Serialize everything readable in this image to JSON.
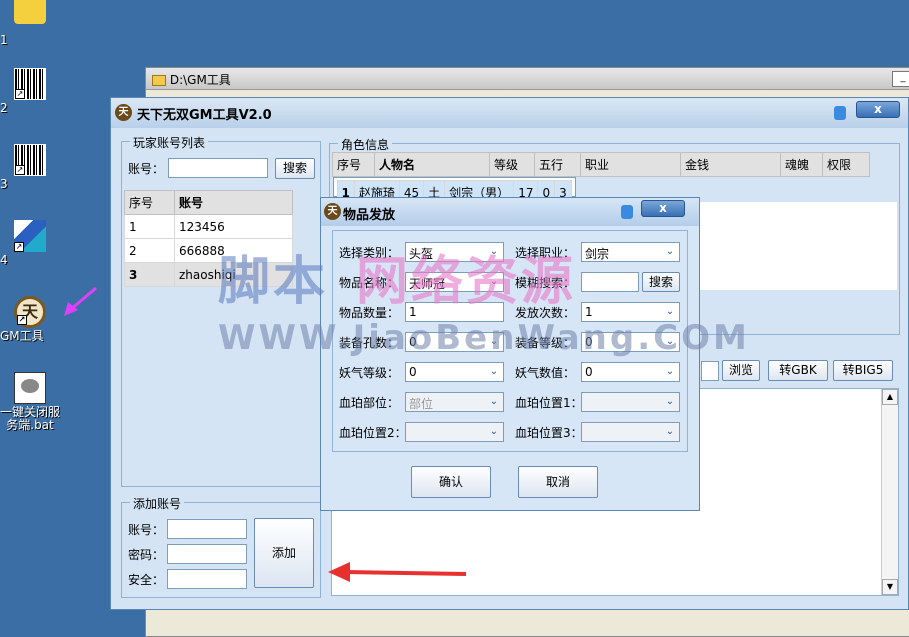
{
  "desktop": {
    "icons": [
      {
        "label": "1",
        "icon": "pikachu-icon"
      },
      {
        "label": "2",
        "icon": "barcode-icon"
      },
      {
        "label": "3",
        "icon": "barcode-icon"
      },
      {
        "label": "4",
        "icon": "cube-icon"
      },
      {
        "label": "GM工具",
        "icon": "tianxia-logo-icon"
      },
      {
        "label": "一键关闭服务端.bat",
        "icon": "bat-file-icon"
      }
    ]
  },
  "bg_window": {
    "title": "D:\\GM工具",
    "close_label": "_"
  },
  "main": {
    "title": "天下无双GM工具V2.0",
    "logo_text": "天",
    "close_label": "x",
    "player_list": {
      "legend": "玩家账号列表",
      "account_label": "账号：",
      "search_button": "搜索",
      "headers": [
        "序号",
        "账号"
      ],
      "rows": [
        [
          "1",
          "123456"
        ],
        [
          "2",
          "666888"
        ],
        [
          "3",
          "zhaoshiqi"
        ]
      ]
    },
    "char_info": {
      "legend": "角色信息",
      "headers": [
        "序号",
        "人物名",
        "等级",
        "五行",
        "职业",
        "金钱",
        "魂魄",
        "权限"
      ],
      "rows": [
        [
          "1",
          "赵施琦",
          "45",
          "土",
          "剑宗（男）",
          "17",
          "0",
          "3"
        ]
      ]
    },
    "toolbar": {
      "browse": "浏览",
      "to_gbk": "转GBK",
      "to_big5": "转BIG5"
    },
    "add_account": {
      "legend": "添加账号",
      "account": "账号：",
      "password": "密码：",
      "security": "安全：",
      "add_button": "添加"
    }
  },
  "dialog": {
    "title": "物品发放",
    "close_label": "x",
    "fields": {
      "category_label": "选择类别：",
      "category_value": "头盔",
      "job_label": "选择职业：",
      "job_value": "剑宗",
      "item_name_label": "物品名称：",
      "item_name_value": "天师冠",
      "fuzzy_label": "模糊搜索：",
      "fuzzy_search_button": "搜索",
      "qty_label": "物品数量：",
      "qty_value": "1",
      "times_label": "发放次数：",
      "times_value": "1",
      "holes_label": "装备孔数：",
      "holes_value": "0",
      "level_label": "装备等级：",
      "level_value": "0",
      "demon_level_label": "妖气等级：",
      "demon_level_value": "0",
      "demon_value_label": "妖气数值：",
      "demon_value_value": "0",
      "blood_part_label": "血珀部位：",
      "blood_part_value": "部位",
      "blood_pos1_label": "血珀位置1：",
      "blood_pos1_value": "",
      "blood_pos2_label": "血珀位置2：",
      "blood_pos2_value": "",
      "blood_pos3_label": "血珀位置3：",
      "blood_pos3_value": ""
    },
    "confirm": "确认",
    "cancel": "取消"
  },
  "watermark": {
    "line1a": "脚本",
    "line1b": "网络资源",
    "line2": "WWW.JiaoBenWang.COM"
  },
  "colors": {
    "desktop": "#3a6ea5",
    "window_bg": "#d4e4f4",
    "arrow_red": "#e8312f",
    "arrow_pink": "#e040fb"
  }
}
